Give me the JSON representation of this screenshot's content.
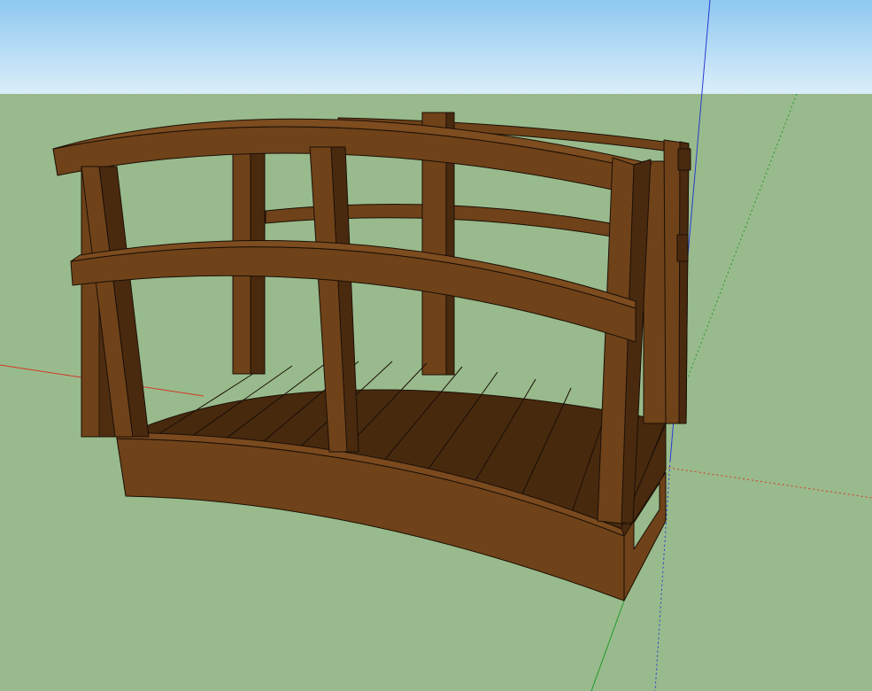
{
  "scene": {
    "sky_top": "#8ec8f0",
    "sky_bottom": "#dbeefa",
    "ground": "#99ba8c",
    "wood_light": "#6f4219",
    "wood_dark": "#4a2a0f",
    "wood_shadow": "#3a210b",
    "outline": "#1a0f06",
    "axis_red": "#d23a2a",
    "axis_green": "#1f9a2a",
    "axis_blue": "#2a3ad2"
  }
}
